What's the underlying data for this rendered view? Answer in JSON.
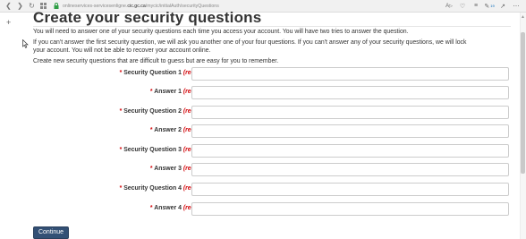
{
  "browser": {
    "url_prefix": "onlineservices-servicesenligne.",
    "url_domain": "cic.gc.ca",
    "url_path": "/mycic/initialAuth/securityQuestions",
    "reader_label": "A",
    "notes_count": "19"
  },
  "page": {
    "title": "Create your security questions",
    "intro_1": "You will need to answer one of your security questions each time you access your account. You will have two tries to answer the question.",
    "intro_2_line1": "If you can't answer the first security question, we will ask you another one of your four questions. If you can't answer any of your security questions, we will lock",
    "intro_2_line2": "your account.  You will not be able to recover your account online.",
    "intro_3": "Create new security questions that are difficult to guess but are easy for you to remember."
  },
  "form": {
    "star": "*",
    "required": "(required)",
    "fields": [
      {
        "label": "Security Question 1",
        "value": ""
      },
      {
        "label": "Answer 1",
        "value": ""
      },
      {
        "label": "Security Question 2",
        "value": ""
      },
      {
        "label": "Answer 2",
        "value": ""
      },
      {
        "label": "Security Question 3",
        "value": ""
      },
      {
        "label": "Answer 3",
        "value": ""
      },
      {
        "label": "Security Question 4",
        "value": ""
      },
      {
        "label": "Answer 4",
        "value": ""
      }
    ],
    "continue_label": "Continue"
  },
  "colors": {
    "required": "#d3080c",
    "button": "#335075"
  }
}
